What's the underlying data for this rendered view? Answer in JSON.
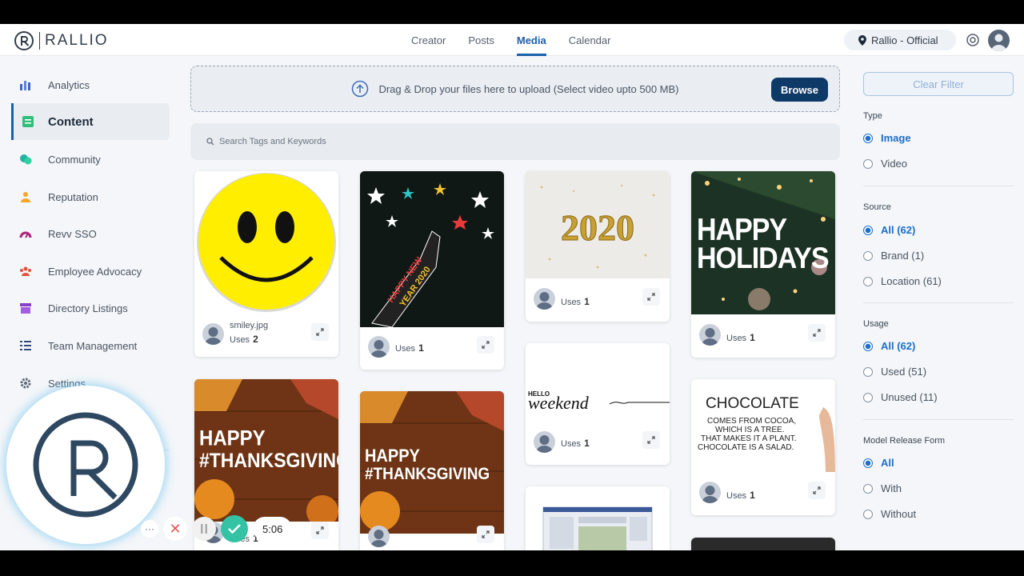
{
  "app": {
    "brand": "RALLIO"
  },
  "nav": {
    "tabs": [
      "Creator",
      "Posts",
      "Media",
      "Calendar"
    ],
    "active": "Media"
  },
  "header": {
    "location": "Rallio - Official"
  },
  "sidebar": {
    "items": [
      {
        "label": "Analytics",
        "icon": "analytics-icon"
      },
      {
        "label": "Content",
        "icon": "content-icon"
      },
      {
        "label": "Community",
        "icon": "community-icon"
      },
      {
        "label": "Reputation",
        "icon": "reputation-icon"
      },
      {
        "label": "Revv SSO",
        "icon": "revv-icon"
      },
      {
        "label": "Employee Advocacy",
        "icon": "advocacy-icon"
      },
      {
        "label": "Directory Listings",
        "icon": "directory-icon"
      },
      {
        "label": "Team Management",
        "icon": "team-icon"
      },
      {
        "label": "Settings",
        "icon": "gear-icon"
      }
    ],
    "active": "Content"
  },
  "upload": {
    "text": "Drag & Drop your files here to upload (Select video upto 500 MB)",
    "button": "Browse"
  },
  "search": {
    "placeholder": "Search Tags and Keywords"
  },
  "media": [
    {
      "name": "smiley.jpg",
      "uses_label": "Uses",
      "uses": "2"
    },
    {
      "name": "",
      "uses_label": "Uses",
      "uses": "1",
      "image_text": "HAPPY NEW YEAR 2020"
    },
    {
      "name": "",
      "uses_label": "Uses",
      "uses": "1",
      "image_text": "2020"
    },
    {
      "name": "",
      "uses_label": "Uses",
      "uses": "1",
      "image_text": "HAPPY HOLIDAYS"
    },
    {
      "name": "",
      "uses_label": "Uses",
      "uses": "1",
      "image_text": "HAPPY #THANKSGIVING"
    },
    {
      "name": "",
      "uses_label": "",
      "uses": "",
      "image_text": "HAPPY #THANKSGIVING"
    },
    {
      "name": "",
      "uses_label": "Uses",
      "uses": "1",
      "image_text": "HELLO weekend"
    },
    {
      "name": "",
      "uses_label": "Uses",
      "uses": "1",
      "image_text": "CHOCOLATE COMES FROM COCOA, WHICH IS A TREE. THAT MAKES IT A PLANT. CHOCOLATE IS A SALAD."
    }
  ],
  "recorder": {
    "time": "5:06",
    "accent": "#33c3a4"
  },
  "filters": {
    "clear": "Clear Filter",
    "groups": [
      {
        "title": "Type",
        "options": [
          "Image",
          "Video"
        ],
        "selected": "Image"
      },
      {
        "title": "Source",
        "options": [
          "All (62)",
          "Brand (1)",
          "Location (61)"
        ],
        "selected": "All (62)"
      },
      {
        "title": "Usage",
        "options": [
          "All (62)",
          "Used (51)",
          "Unused (11)"
        ],
        "selected": "All (62)"
      },
      {
        "title": "Model Release Form",
        "options": [
          "All",
          "With",
          "Without"
        ],
        "selected": "All"
      }
    ]
  },
  "colors": {
    "primary": "#1b5fa8",
    "navy": "#0e3a68",
    "accent": "#1b6fc8"
  }
}
